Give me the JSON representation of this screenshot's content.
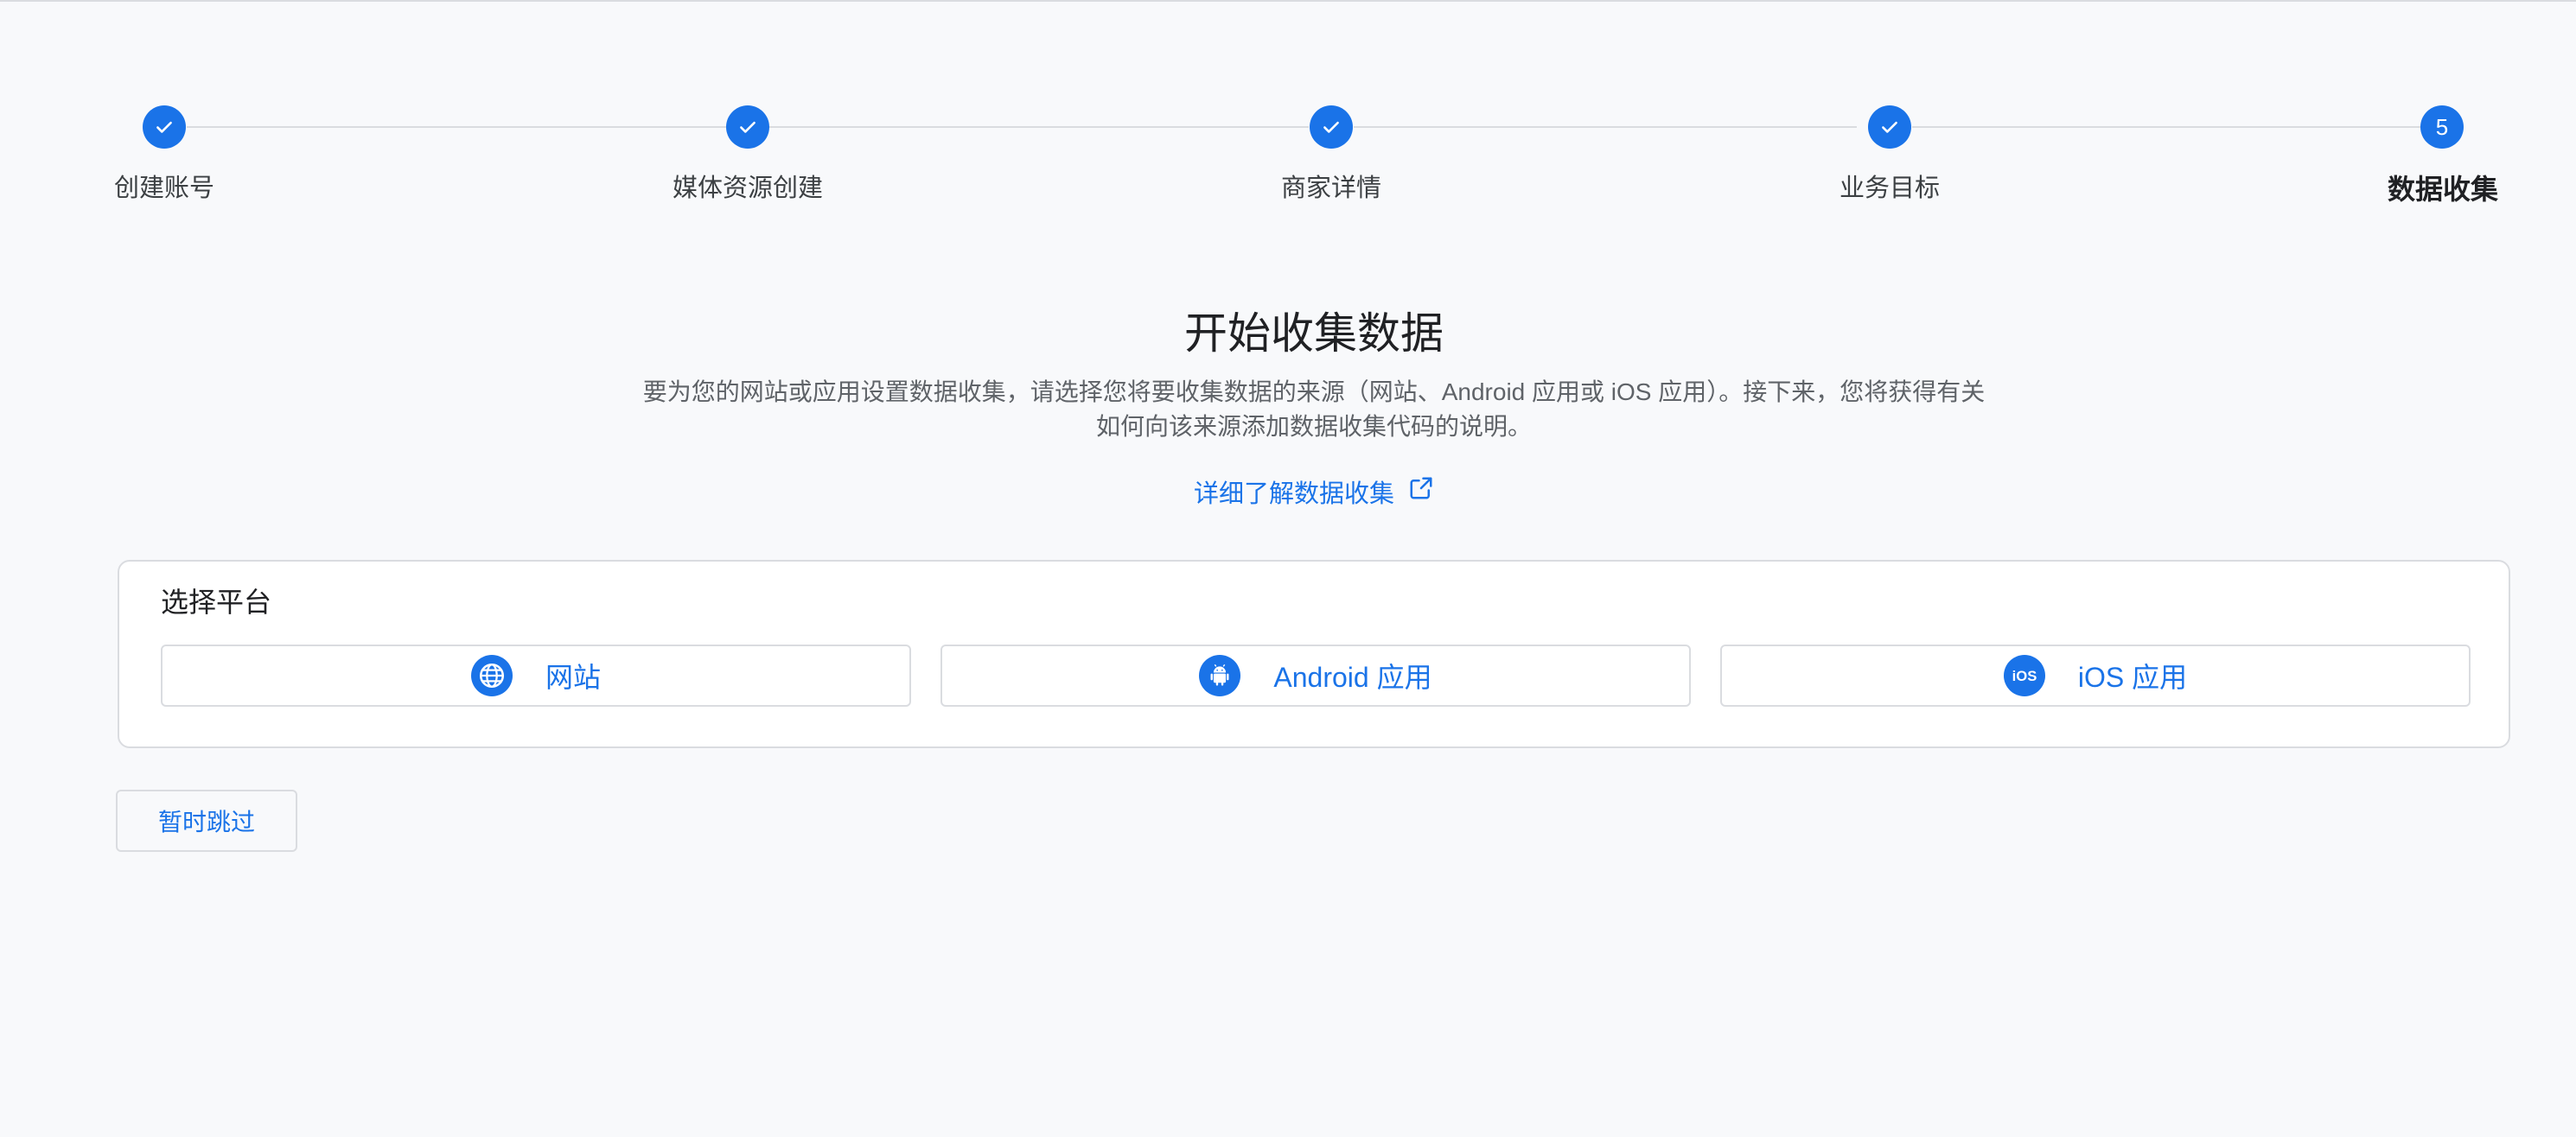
{
  "stepper": {
    "steps": [
      {
        "label": "创建账号",
        "state": "done"
      },
      {
        "label": "媒体资源创建",
        "state": "done"
      },
      {
        "label": "商家详情",
        "state": "done"
      },
      {
        "label": "业务目标",
        "state": "done"
      },
      {
        "label": "数据收集",
        "state": "current",
        "number": "5"
      }
    ]
  },
  "header": {
    "title": "开始收集数据",
    "description_line1": "要为您的网站或应用设置数据收集，请选择您将要收集数据的来源（网站、Android 应用或 iOS 应用）。接下来，您将获得有关",
    "description_line2": "如何向该来源添加数据收集代码的说明。",
    "learn_more": "详细了解数据收集"
  },
  "platform_card": {
    "title": "选择平台",
    "options": [
      {
        "label": "网站",
        "icon": "globe-icon"
      },
      {
        "label": "Android 应用",
        "icon": "android-icon"
      },
      {
        "label": "iOS 应用",
        "icon": "ios-icon"
      }
    ]
  },
  "actions": {
    "skip_label": "暂时跳过"
  },
  "colors": {
    "accent": "#1a73e8",
    "background": "#f8f9fb",
    "border": "#dadce0"
  }
}
